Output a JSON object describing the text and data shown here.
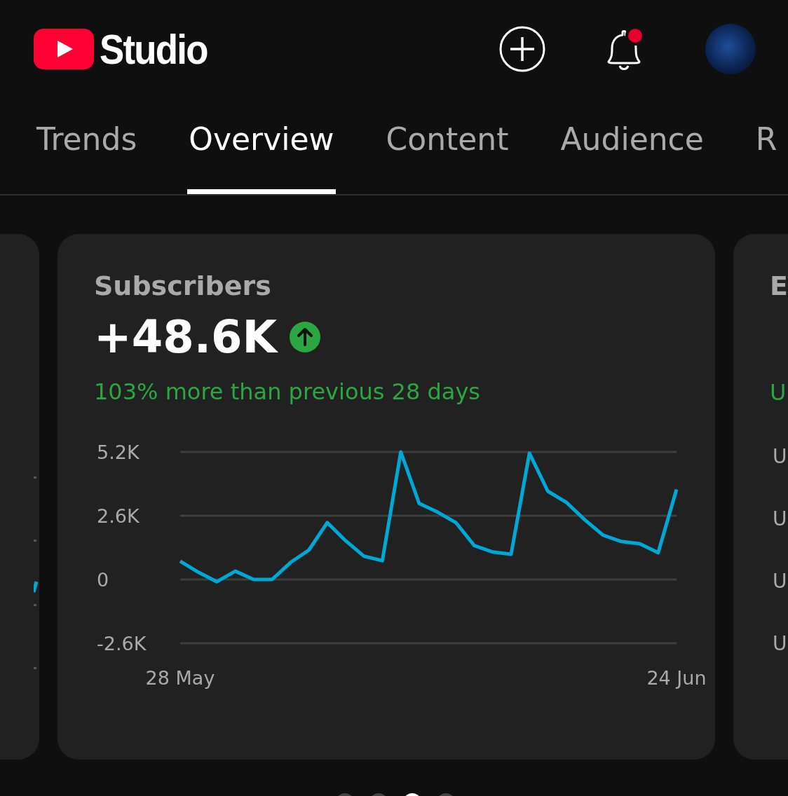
{
  "header": {
    "app_name": "Studio",
    "notification_unread": true
  },
  "tabs": [
    {
      "label": "Trends",
      "selected": false
    },
    {
      "label": "Overview",
      "selected": true
    },
    {
      "label": "Content",
      "selected": false
    },
    {
      "label": "Audience",
      "selected": false
    },
    {
      "label": "R",
      "selected": false
    }
  ],
  "cards": [
    {
      "title": "Subscribers",
      "value": "+48.6K",
      "trending_up": true,
      "comparison": "103% more than previous 28 days",
      "chart_data": {
        "type": "line",
        "x": [
          "28 May",
          null,
          null,
          null,
          null,
          null,
          null,
          null,
          null,
          null,
          null,
          null,
          null,
          null,
          null,
          null,
          null,
          null,
          null,
          null,
          null,
          null,
          null,
          null,
          null,
          null,
          null,
          "24 Jun"
        ],
        "series": [
          {
            "color": "#00a8d6",
            "values": [
              750,
              290,
              -90,
              340,
              0,
              0,
              690,
              1200,
              2320,
              1580,
              950,
              770,
              5200,
              3100,
              2750,
              2320,
              1380,
              1120,
              1030,
              5150,
              3600,
              3150,
              2440,
              1810,
              1550,
              1460,
              1090,
              3670
            ]
          }
        ],
        "ylim": [
          -2600,
          5200
        ],
        "yticks": [
          {
            "value": 5200,
            "label": "5.2K"
          },
          {
            "value": 2600,
            "label": "2.6K"
          },
          {
            "value": 0,
            "label": "0"
          },
          {
            "value": -2600,
            "label": "-2.6K"
          }
        ]
      }
    }
  ],
  "next_card": {
    "title": "E",
    "comparison": "U",
    "axis_labels": [
      "U",
      "U",
      "U",
      "U"
    ]
  },
  "page_dots": [
    {
      "selected": false
    },
    {
      "selected": false
    },
    {
      "selected": true
    },
    {
      "selected": false
    }
  ]
}
